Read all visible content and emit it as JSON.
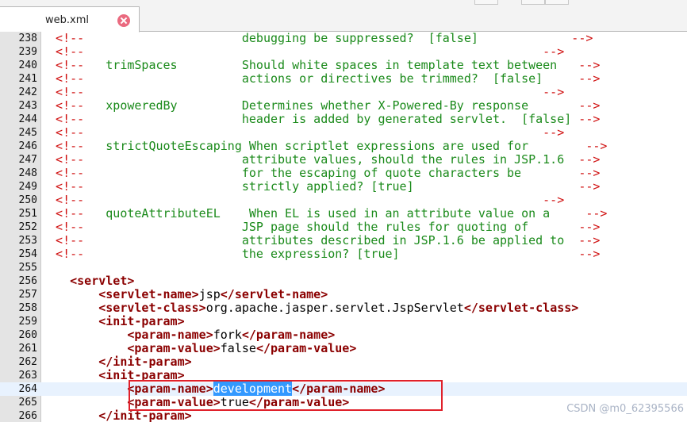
{
  "tab": {
    "label": "web.xml"
  },
  "watermark": "CSDN @m0_62395566",
  "lines": [
    {
      "n": "238",
      "parts": [
        [
          "cm",
          "  <!--"
        ],
        [
          "ct",
          "                      debugging be suppressed?  [false]"
        ],
        [
          "cm",
          "             -->"
        ]
      ]
    },
    {
      "n": "239",
      "parts": [
        [
          "cm",
          "  <!--"
        ],
        [
          "cm",
          "                                                                -->"
        ]
      ]
    },
    {
      "n": "240",
      "parts": [
        [
          "cm",
          "  <!--"
        ],
        [
          "ct",
          "   trimSpaces         Should white spaces in template text between"
        ],
        [
          "cm",
          "   -->"
        ]
      ]
    },
    {
      "n": "241",
      "parts": [
        [
          "cm",
          "  <!--"
        ],
        [
          "ct",
          "                      actions or directives be trimmed?  [false]"
        ],
        [
          "cm",
          "     -->"
        ]
      ]
    },
    {
      "n": "242",
      "parts": [
        [
          "cm",
          "  <!--"
        ],
        [
          "cm",
          "                                                                -->"
        ]
      ]
    },
    {
      "n": "243",
      "parts": [
        [
          "cm",
          "  <!--"
        ],
        [
          "ct",
          "   xpoweredBy         Determines whether X-Powered-By response"
        ],
        [
          "cm",
          "       -->"
        ]
      ]
    },
    {
      "n": "244",
      "parts": [
        [
          "cm",
          "  <!--"
        ],
        [
          "ct",
          "                      header is added by generated servlet.  [false]"
        ],
        [
          "cm",
          " -->"
        ]
      ]
    },
    {
      "n": "245",
      "parts": [
        [
          "cm",
          "  <!--"
        ],
        [
          "cm",
          "                                                                -->"
        ]
      ]
    },
    {
      "n": "246",
      "parts": [
        [
          "cm",
          "  <!--"
        ],
        [
          "ct",
          "   strictQuoteEscaping When scriptlet expressions are used for"
        ],
        [
          "cm",
          "        -->"
        ]
      ]
    },
    {
      "n": "247",
      "parts": [
        [
          "cm",
          "  <!--"
        ],
        [
          "ct",
          "                      attribute values, should the rules in JSP.1.6"
        ],
        [
          "cm",
          "  -->"
        ]
      ]
    },
    {
      "n": "248",
      "parts": [
        [
          "cm",
          "  <!--"
        ],
        [
          "ct",
          "                      for the escaping of quote characters be"
        ],
        [
          "cm",
          "        -->"
        ]
      ]
    },
    {
      "n": "249",
      "parts": [
        [
          "cm",
          "  <!--"
        ],
        [
          "ct",
          "                      strictly applied? [true]"
        ],
        [
          "cm",
          "                       -->"
        ]
      ]
    },
    {
      "n": "250",
      "parts": [
        [
          "cm",
          "  <!--"
        ],
        [
          "cm",
          "                                                                -->"
        ]
      ]
    },
    {
      "n": "251",
      "parts": [
        [
          "cm",
          "  <!--"
        ],
        [
          "ct",
          "   quoteAttributeEL    When EL is used in an attribute value on a"
        ],
        [
          "cm",
          "     -->"
        ]
      ]
    },
    {
      "n": "252",
      "parts": [
        [
          "cm",
          "  <!--"
        ],
        [
          "ct",
          "                      JSP page should the rules for quoting of"
        ],
        [
          "cm",
          "       -->"
        ]
      ]
    },
    {
      "n": "253",
      "parts": [
        [
          "cm",
          "  <!--"
        ],
        [
          "ct",
          "                      attributes described in JSP.1.6 be applied to"
        ],
        [
          "cm",
          "  -->"
        ]
      ]
    },
    {
      "n": "254",
      "parts": [
        [
          "cm",
          "  <!--"
        ],
        [
          "ct",
          "                      the expression? [true]"
        ],
        [
          "cm",
          "                         -->"
        ]
      ]
    },
    {
      "n": "255",
      "parts": []
    },
    {
      "n": "256",
      "parts": [
        [
          "tx",
          "    "
        ],
        [
          "tg",
          "<servlet>"
        ]
      ]
    },
    {
      "n": "257",
      "parts": [
        [
          "tx",
          "        "
        ],
        [
          "tg",
          "<servlet-name>"
        ],
        [
          "tx",
          "jsp"
        ],
        [
          "tg",
          "</servlet-name>"
        ]
      ]
    },
    {
      "n": "258",
      "parts": [
        [
          "tx",
          "        "
        ],
        [
          "tg",
          "<servlet-class>"
        ],
        [
          "tx",
          "org.apache.jasper.servlet.JspServlet"
        ],
        [
          "tg",
          "</servlet-class>"
        ]
      ]
    },
    {
      "n": "259",
      "parts": [
        [
          "tx",
          "        "
        ],
        [
          "tg",
          "<init-param>"
        ]
      ]
    },
    {
      "n": "260",
      "parts": [
        [
          "tx",
          "            "
        ],
        [
          "tg",
          "<param-name>"
        ],
        [
          "tx",
          "fork"
        ],
        [
          "tg",
          "</param-name>"
        ]
      ]
    },
    {
      "n": "261",
      "parts": [
        [
          "tx",
          "            "
        ],
        [
          "tg",
          "<param-value>"
        ],
        [
          "tx",
          "false"
        ],
        [
          "tg",
          "</param-value>"
        ]
      ]
    },
    {
      "n": "262",
      "parts": [
        [
          "tx",
          "        "
        ],
        [
          "tg",
          "</init-param>"
        ]
      ]
    },
    {
      "n": "263",
      "parts": [
        [
          "tx",
          "        "
        ],
        [
          "tg",
          "<init-param>"
        ]
      ]
    },
    {
      "n": "264",
      "current": true,
      "parts": [
        [
          "tx",
          "            "
        ],
        [
          "tg",
          "<param-name>"
        ],
        [
          "sel",
          "development"
        ],
        [
          "tg",
          "</param-name>"
        ]
      ]
    },
    {
      "n": "265",
      "parts": [
        [
          "tx",
          "            "
        ],
        [
          "tg",
          "<param-value>"
        ],
        [
          "tx",
          "true"
        ],
        [
          "tg",
          "</param-value>"
        ]
      ]
    },
    {
      "n": "266",
      "parts": [
        [
          "tx",
          "        "
        ],
        [
          "tg",
          "</init-param>"
        ]
      ]
    }
  ]
}
